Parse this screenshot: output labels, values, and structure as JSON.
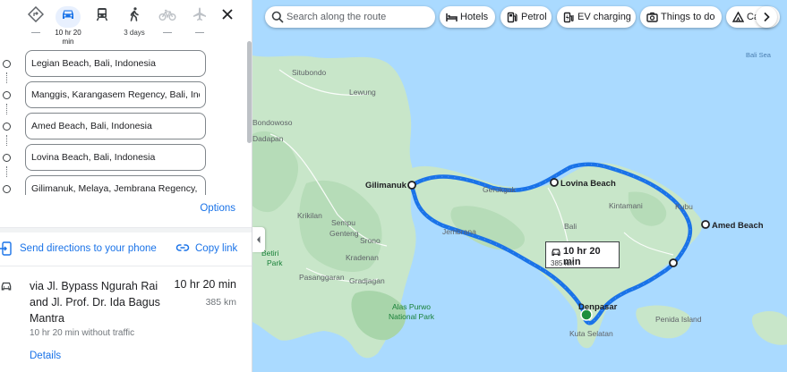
{
  "travel_modes": [
    {
      "name": "best",
      "icon": "diamond-route-icon",
      "time": "",
      "active": false
    },
    {
      "name": "driving",
      "icon": "car-icon",
      "time": "10 hr 20 min",
      "active": true
    },
    {
      "name": "transit",
      "icon": "train-icon",
      "time": "",
      "active": false
    },
    {
      "name": "walking",
      "icon": "walk-icon",
      "time": "3 days",
      "active": false
    },
    {
      "name": "cycling",
      "icon": "bike-icon",
      "time": "",
      "active": false
    },
    {
      "name": "flights",
      "icon": "plane-icon",
      "time": "",
      "active": false
    }
  ],
  "stops": [
    "Legian Beach, Bali, Indonesia",
    "Manggis, Karangasem Regency, Bali, Indonesia",
    "Amed Beach, Bali, Indonesia",
    "Lovina Beach, Bali, Indonesia",
    "Gilimanuk, Melaya, Jembrana Regency, Bali, Indonesia"
  ],
  "options_label": "Options",
  "send_directions_label": "Send directions to your phone",
  "copy_link_label": "Copy link",
  "route": {
    "via": "via Jl. Bypass Ngurah Rai and Jl. Prof. Dr. Ida Bagus Mantra",
    "time": "10 hr 20 min",
    "distance": "385 km",
    "traffic": "10 hr 20 min without traffic",
    "details_label": "Details"
  },
  "map": {
    "search_placeholder": "Search along the route",
    "chips": [
      "Hotels",
      "Petrol",
      "EV charging",
      "Things to do",
      "Cafes"
    ],
    "callout": {
      "time": "10 hr 20 min",
      "distance": "385 km"
    },
    "labels": {
      "sea": "Bali Sea",
      "situbondo": "Situbondo",
      "lewung": "Lewung",
      "bondowoso": "Bondowoso",
      "dadapan": "Dadapan",
      "krikilan": "Krikilan",
      "sempu": "Sempu",
      "genteng": "Genteng",
      "srono": "Srono",
      "betiri": "Betiri",
      "park": "Park",
      "kradenan": "Kradenan",
      "pasanggaran": "Pasanggaran",
      "gradjagan": "Gradjagan",
      "alas_purwo_1": "Alas Purwo",
      "alas_purwo_2": "National Park",
      "gilimanuk": "Gilimanuk",
      "lovina": "Lovina Beach",
      "gerokgak": "Gerokgak",
      "kintamani": "Kintamani",
      "kubu": "Kubu",
      "amed": "Amed Beach",
      "bali": "Bali",
      "jembrana": "Jembrana",
      "denpasar": "Denpasar",
      "kuta_selatan": "Kuta Selatan",
      "penida": "Penida Island"
    }
  }
}
